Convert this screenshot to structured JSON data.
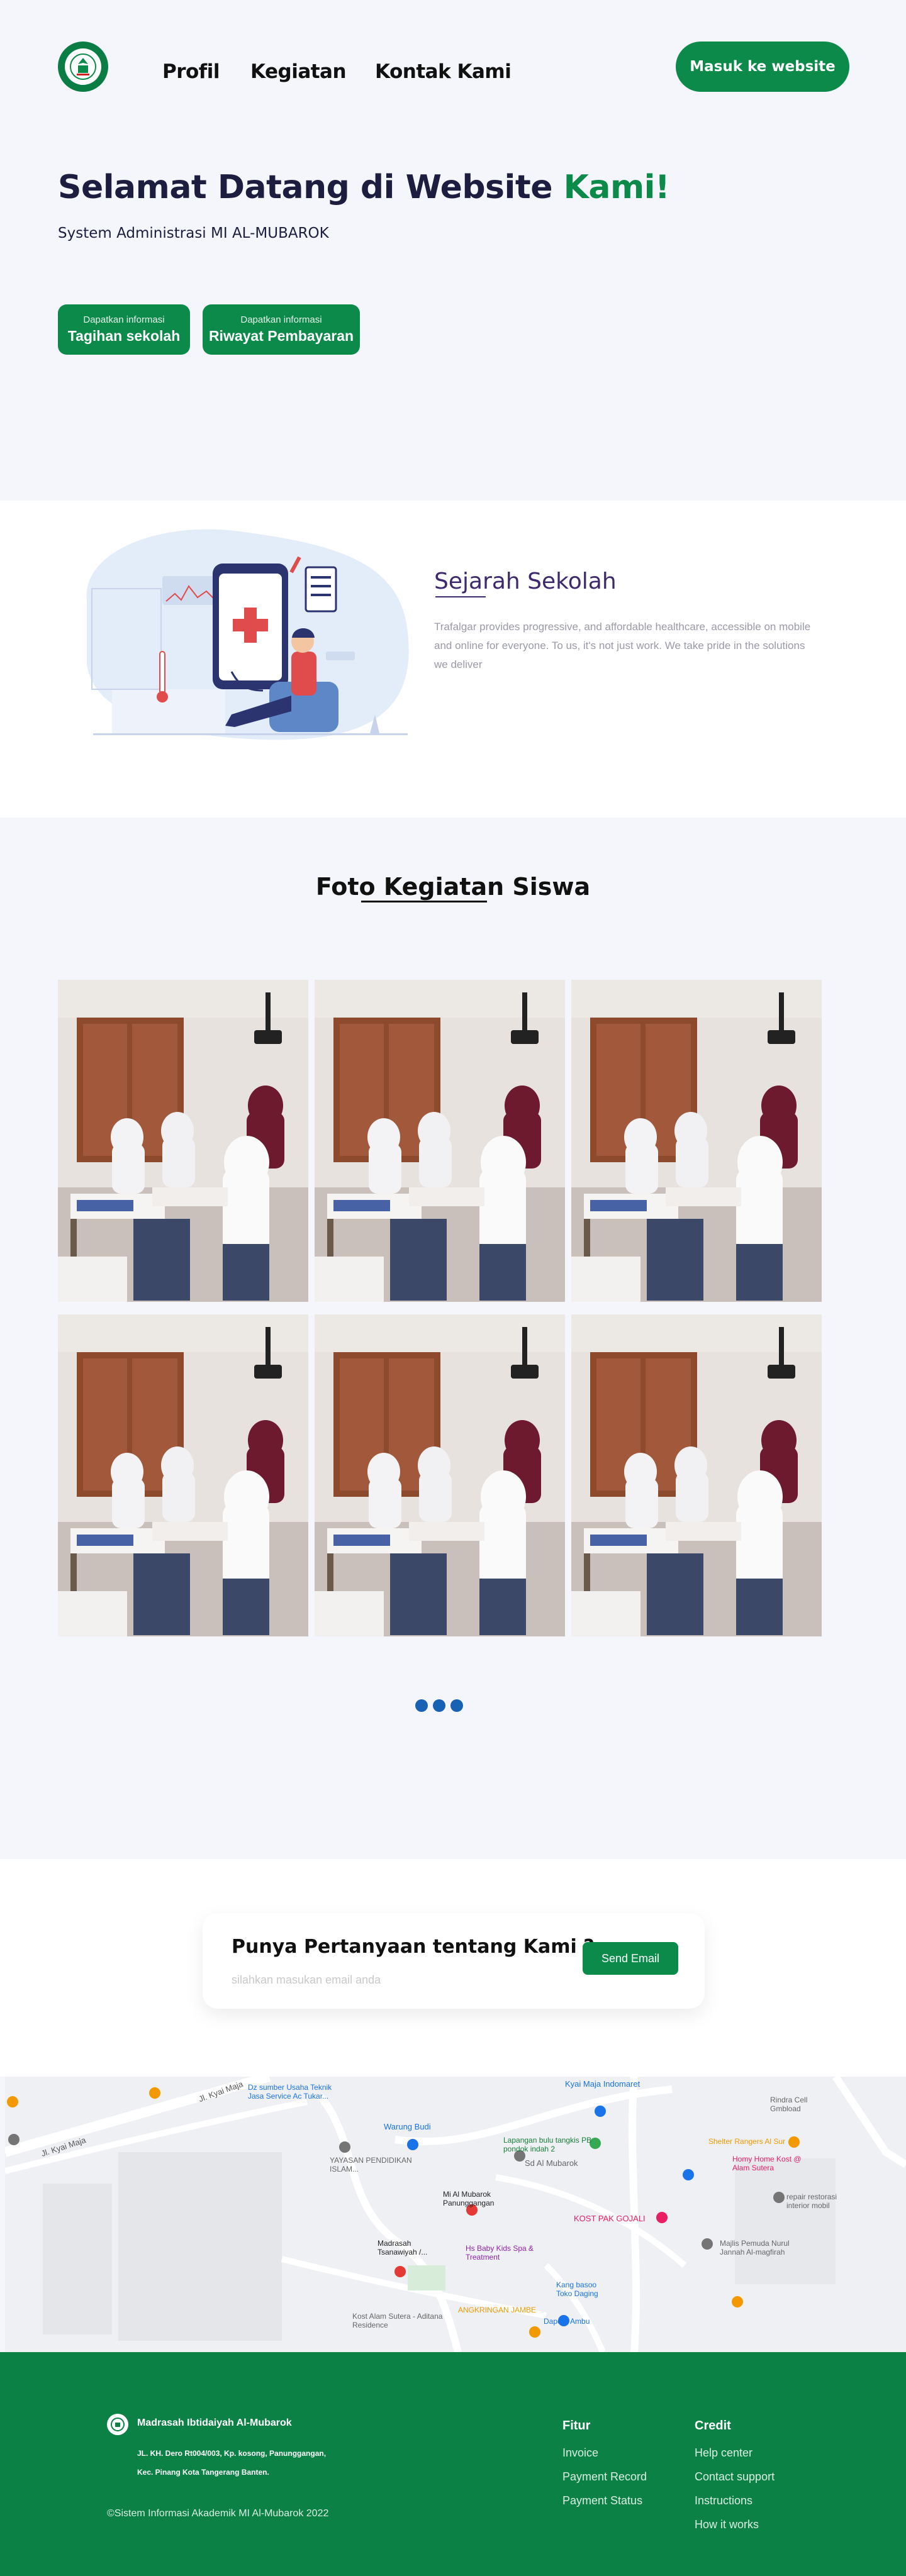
{
  "header": {
    "nav": [
      "Profil",
      "Kegiatan",
      "Kontak Kami"
    ],
    "login_label": "Masuk ke website"
  },
  "hero": {
    "title_main": "Selamat Datang di Website ",
    "title_accent": "Kami!",
    "subtitle": "System Administrasi  MI AL-MUBAROK",
    "buttons": [
      {
        "small": "Dapatkan informasi",
        "big": "Tagihan sekolah"
      },
      {
        "small": "Dapatkan informasi",
        "big": "Riwayat Pembayaran"
      }
    ]
  },
  "sejarah": {
    "title": "Sejarah Sekolah",
    "text": "Trafalgar provides progressive, and affordable healthcare, accessible on mobile and online for everyone. To us, it's not just work. We take pride in the solutions we deliver"
  },
  "foto": {
    "title": "Foto Kegiatan Siswa",
    "photo_count": 6,
    "dots": 3
  },
  "question": {
    "title": "Punya Pertanyaan tentang Kami ?",
    "placeholder": "silahkan masukan email anda",
    "button": "Send Email"
  },
  "map": {
    "labels": [
      "Jl. Kyai Maja",
      "Kyai Maja Indomaret",
      "Warung Budi",
      "Lapangan bulu tangkis PB pondok indah 2",
      "YAYASAN PENDIDIKAN ISLAM...",
      "Sd Al Mubarok",
      "Mi Al Mubarok Panunggangan",
      "Madrasah Tsanawiyah /...",
      "KOST PAK GOJALI",
      "Hs Baby Kids Spa & Treatment",
      "Kang basoo Toko Daging",
      "Kost Alam Sutera - Aditana Residence",
      "ANGKRINGAN JAMBE",
      "Dapoer Ambu",
      "Rindra Cell Gmbload",
      "Homy Home Kost @ Alam Sutera",
      "Majlis Pemuda Nurul Jannah Al-magfirah",
      "repair restorasi interior mobil",
      "Shelter Rangers Al Sur",
      "Dz sumber Usaha Teknik Jasa Service Ac Tukar...",
      "Jl. Kyai Maja"
    ]
  },
  "footer": {
    "name": "Madrasah Ibtidaiyah Al-Mubarok",
    "address_1": "JL. KH. Dero Rt004/003, Kp. kosong, Panunggangan,",
    "address_2": "Kec. Pinang Kota Tangerang Banten.",
    "copyright": "©Sistem Informasi Akademik  MI Al-Mubarok 2022",
    "col1": {
      "title": "Fitur",
      "links": [
        "Invoice",
        "Payment Record",
        "Payment Status"
      ]
    },
    "col2": {
      "title": "Credit",
      "links": [
        "Help center",
        "Contact support",
        "Instructions",
        "How it works"
      ]
    }
  },
  "colors": {
    "brand_green": "#0b8a4a",
    "footer_green": "#0b8146",
    "title_purple": "#3d2a6e",
    "dot_blue": "#1862b5"
  }
}
